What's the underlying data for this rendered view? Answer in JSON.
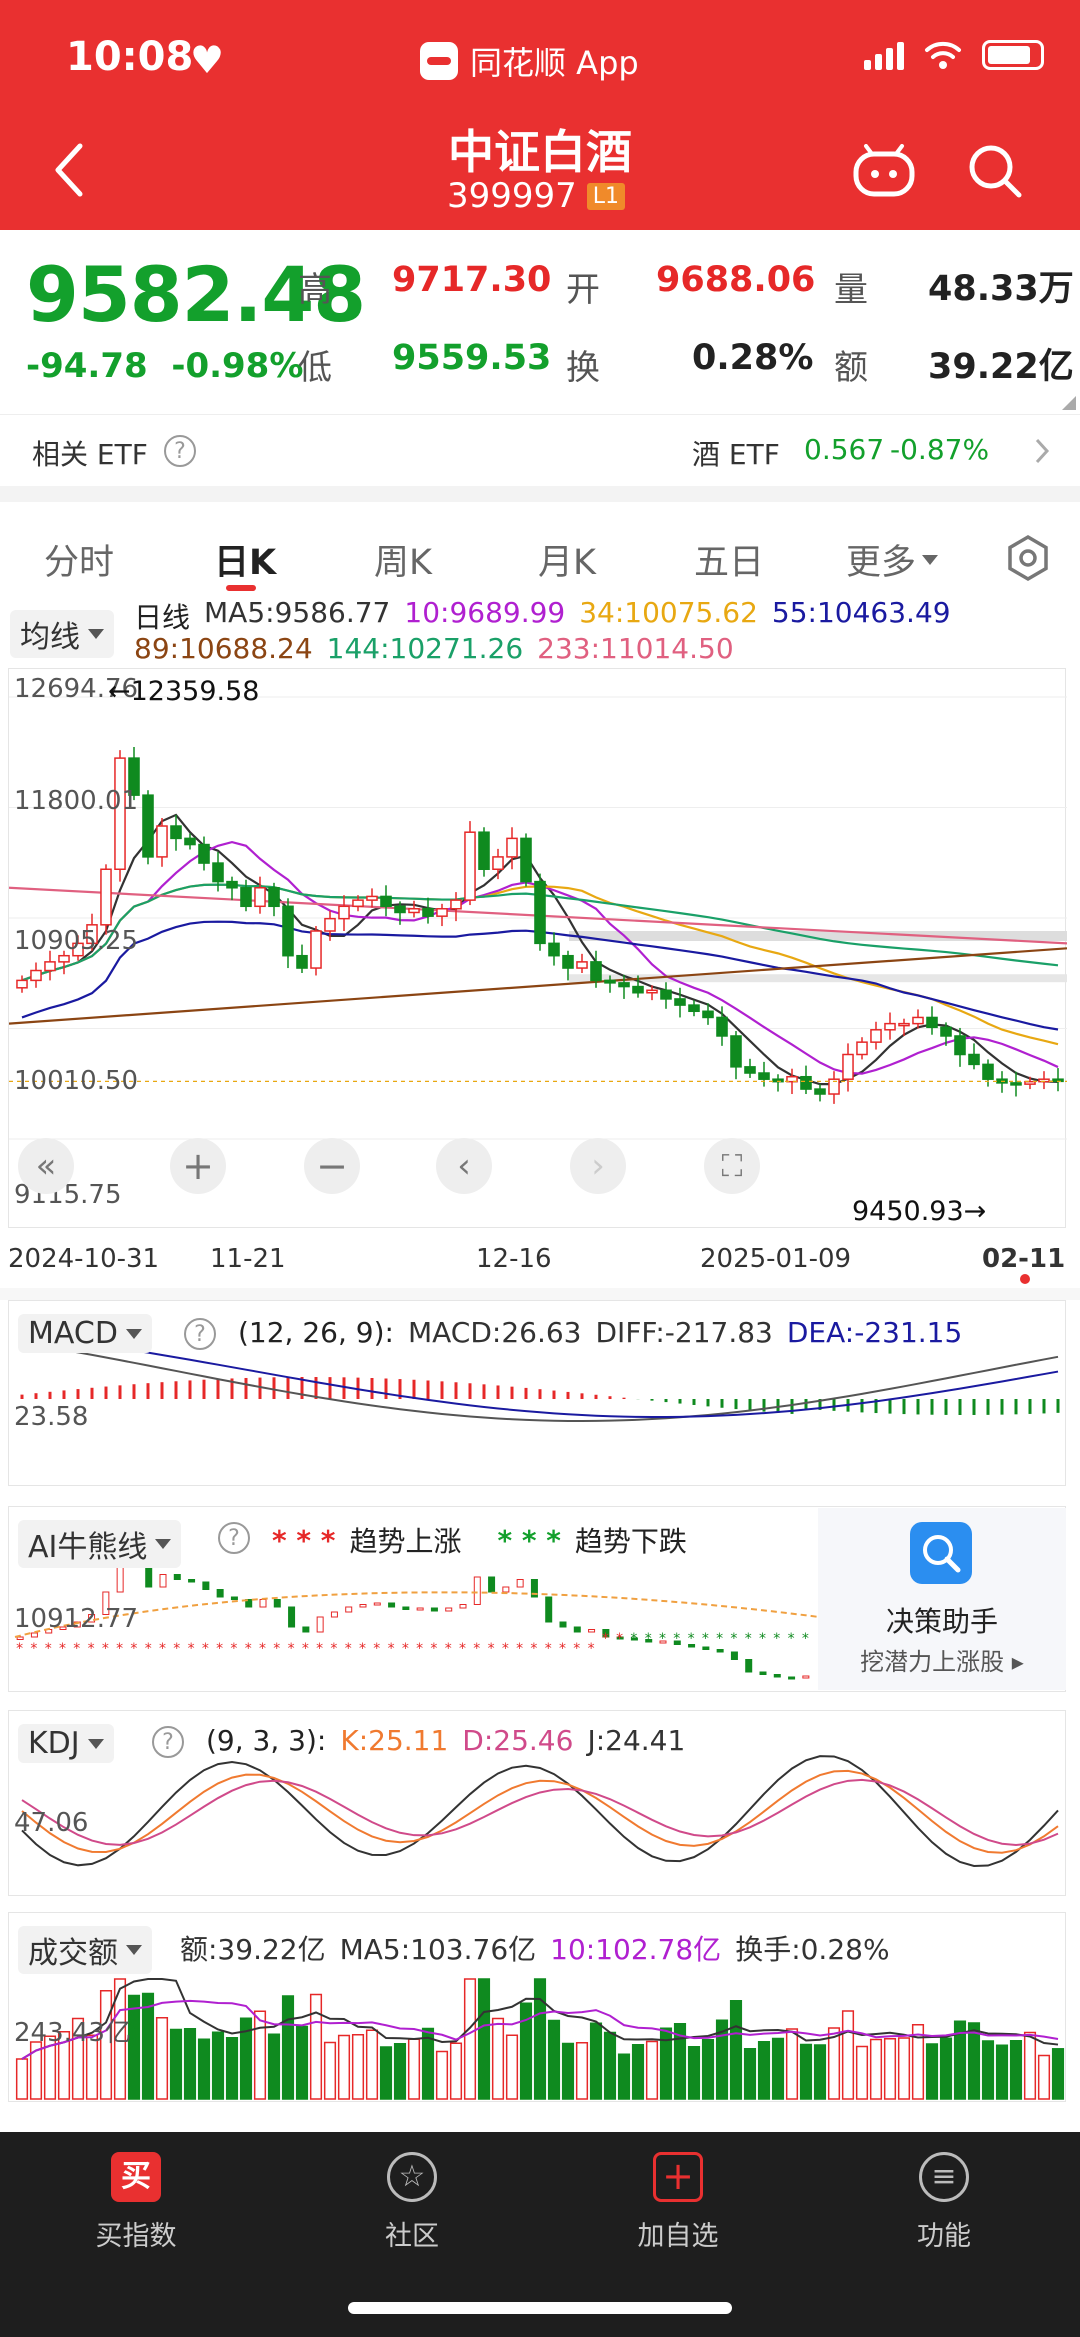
{
  "status": {
    "time": "10:08",
    "app": "同花顺 App"
  },
  "header": {
    "title": "中证白酒",
    "code": "399997",
    "level": "L1"
  },
  "quote": {
    "price": "9582.48",
    "change": "-94.78",
    "change_pct": "-0.98%",
    "high_label": "高",
    "high": "9717.30",
    "open_label": "开",
    "open": "9688.06",
    "vol_label": "量",
    "vol": "48.33万",
    "low_label": "低",
    "low": "9559.53",
    "turnover_label": "换",
    "turnover": "0.28%",
    "amount_label": "额",
    "amount": "39.22亿"
  },
  "etf": {
    "label": "相关 ETF",
    "name": "酒 ETF",
    "price": "0.567",
    "pct": "-0.87%"
  },
  "tabs": [
    "分时",
    "日K",
    "周K",
    "月K",
    "五日",
    "更多"
  ],
  "main_chart": {
    "selector": "均线",
    "ma_line1": [
      {
        "text": "日线",
        "color": "#222222"
      },
      {
        "text": "MA5:9586.77",
        "color": "#333333"
      },
      {
        "text": "10:9689.99",
        "color": "#b020d0"
      },
      {
        "text": "34:10075.62",
        "color": "#e8a812"
      },
      {
        "text": "55:10463.49",
        "color": "#1a1aa0"
      }
    ],
    "ma_line2": [
      {
        "text": "89:10688.24",
        "color": "#8b4513"
      },
      {
        "text": "144:10271.26",
        "color": "#1aa068"
      },
      {
        "text": "233:11014.50",
        "color": "#e06080"
      }
    ],
    "y_top": "12694.76",
    "y_2": "11800.01",
    "y_3": "10905.25",
    "y_4": "10010.50",
    "y_bottom": "9115.75",
    "high_mark": "←12359.58",
    "low_mark": "9450.93→",
    "dates": [
      "2024-10-31",
      "11-21",
      "12-16",
      "2025-01-09",
      "02-11"
    ]
  },
  "chart_data": {
    "type": "candlestick",
    "ylim": [
      9115.75,
      12694.76
    ],
    "y_ticks": [
      12694.76,
      11800.01,
      10905.25,
      10010.5,
      9115.75
    ],
    "x_ticks": [
      "2024-10-31",
      "11-21",
      "12-16",
      "2025-01-09",
      "02-11"
    ],
    "last_close": 9582.48,
    "period_high": 12359.58,
    "period_low": 9450.93,
    "closes": [
      10400,
      10480,
      10550,
      10600,
      10700,
      10850,
      11300,
      12200,
      11900,
      11400,
      11650,
      11550,
      11500,
      11350,
      11200,
      11150,
      11000,
      11150,
      11000,
      10600,
      10500,
      10800,
      10900,
      11000,
      11050,
      11080,
      11000,
      10950,
      10980,
      10920,
      10980,
      11050,
      11600,
      11300,
      11400,
      11550,
      11200,
      10700,
      10600,
      10500,
      10550,
      10400,
      10380,
      10350,
      10300,
      10320,
      10250,
      10200,
      10150,
      10100,
      9950,
      9700,
      9650,
      9600,
      9580,
      9620,
      9520,
      9480,
      9600,
      9800,
      9900,
      10000,
      10050,
      10050,
      10100,
      10020,
      9950,
      9800,
      9720,
      9600,
      9570,
      9560,
      9580,
      9600,
      9582.48
    ],
    "ma_values": {
      "MA5": 9586.77,
      "MA10": 9689.99,
      "MA34": 10075.62,
      "MA55": 10463.49,
      "MA89": 10688.24,
      "MA144": 10271.26,
      "MA233": 11014.5
    }
  },
  "macd": {
    "selector": "MACD",
    "params": "(12, 26, 9):",
    "macd": "MACD:26.63",
    "diff": "DIFF:-217.83",
    "dea": "DEA:-231.15",
    "y_label": "23.58"
  },
  "ai": {
    "selector": "AI牛熊线",
    "up_legend": "趋势上涨",
    "down_legend": "趋势下跌",
    "y_label": "10912.77",
    "assist_title": "决策助手",
    "assist_sub": "挖潜力上涨股"
  },
  "kdj": {
    "selector": "KDJ",
    "params": "(9, 3, 3):",
    "k": "K:25.11",
    "d": "D:25.46",
    "j": "J:24.41",
    "y_label": "47.06"
  },
  "vol": {
    "selector": "成交额",
    "amount": "额:39.22亿",
    "ma5": "MA5:103.76亿",
    "ma10": "10:102.78亿",
    "turnover": "换手:0.28%",
    "y_label": "243.43亿"
  },
  "nav": [
    {
      "label": "买指数",
      "icon": "买"
    },
    {
      "label": "社区",
      "icon": "☆"
    },
    {
      "label": "加自选",
      "icon": "+"
    },
    {
      "label": "功能",
      "icon": "≡"
    }
  ]
}
